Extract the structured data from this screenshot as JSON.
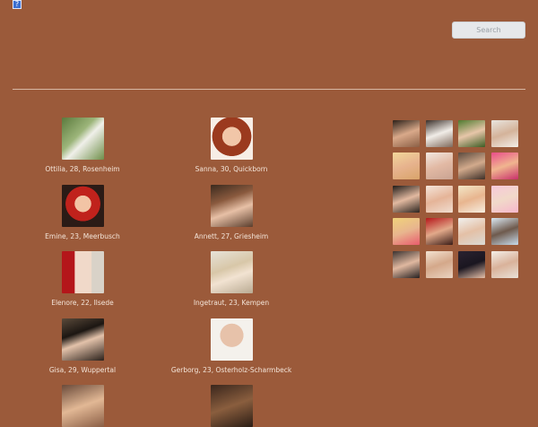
{
  "header": {
    "search_placeholder": "Search"
  },
  "profiles": [
    {
      "caption": "Ottilia, 28, Rosenheim"
    },
    {
      "caption": "Sanna, 30, Quickborn"
    },
    {
      "caption": "Emine, 23, Meerbusch"
    },
    {
      "caption": "Annett, 27, Griesheim"
    },
    {
      "caption": "Elenore, 22, Ilsede"
    },
    {
      "caption": "Ingetraut, 23, Kempen"
    },
    {
      "caption": "Gisa, 29, Wuppertal"
    },
    {
      "caption": "Gerborg, 23, Osterholz-Scharmbeck"
    },
    {
      "caption": ""
    },
    {
      "caption": ""
    }
  ],
  "colors": {
    "background": "#9b5a3a",
    "text": "#f3e4d8",
    "divider": "#d6b7a3"
  }
}
